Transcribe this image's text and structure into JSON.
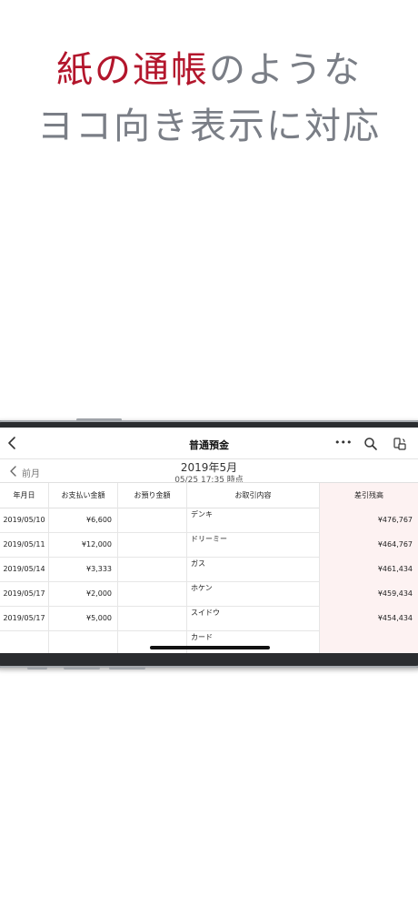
{
  "headline": {
    "line1_accent": "紙の通帳",
    "line1_rest": "のような",
    "line2": "ヨコ向き表示に対応",
    "accent_color": "#b3162c",
    "text_color": "#7a7e86"
  },
  "app": {
    "title": "普通預金",
    "back_icon": "chevron-left-icon",
    "more_label": "•••",
    "search_icon": "search-icon",
    "rotate_icon": "rotate-icon"
  },
  "subheader": {
    "prev_label": "前月",
    "month": "2019年5月",
    "as_of": "05/25 17:35 時点"
  },
  "table": {
    "columns": [
      "年月日",
      "お支払い金額",
      "お預り金額",
      "お取引内容",
      "差引残高"
    ],
    "rows": [
      {
        "date": "2019/05/10",
        "payment": "¥6,600",
        "deposit": "",
        "description": "デンキ",
        "balance": "¥476,767"
      },
      {
        "date": "2019/05/11",
        "payment": "¥12,000",
        "deposit": "",
        "description": "ドリーミー",
        "balance": "¥464,767"
      },
      {
        "date": "2019/05/14",
        "payment": "¥3,333",
        "deposit": "",
        "description": "ガス",
        "balance": "¥461,434"
      },
      {
        "date": "2019/05/17",
        "payment": "¥2,000",
        "deposit": "",
        "description": "ホケン",
        "balance": "¥459,434"
      },
      {
        "date": "2019/05/17",
        "payment": "¥5,000",
        "deposit": "",
        "description": "スイドウ",
        "balance": "¥454,434"
      },
      {
        "date": "",
        "payment": "",
        "deposit": "",
        "description": "カード",
        "balance": ""
      }
    ]
  }
}
